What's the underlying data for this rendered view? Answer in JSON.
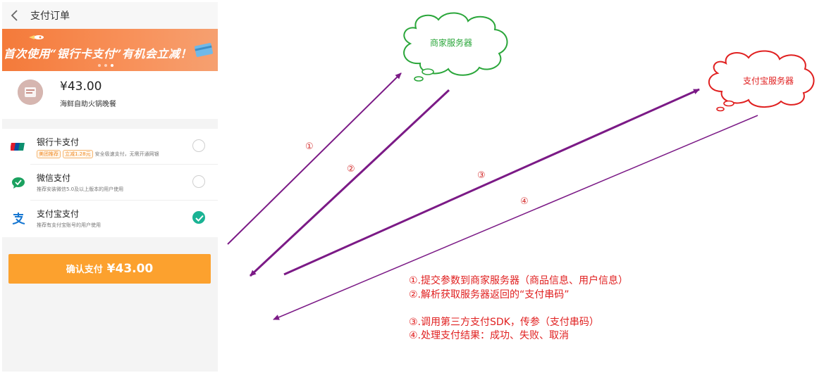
{
  "phone": {
    "nav_title": "支付订单",
    "banner_text": "首次使用“银行卡支付”有机会立减！",
    "order": {
      "price": "¥43.00",
      "name": "海鲜自助火锅晚餐"
    },
    "methods": [
      {
        "title": "银行卡支付",
        "tags": [
          "美团推荐",
          "立减1.28元"
        ],
        "desc": "安全极速支付，无需开通网银",
        "icon": "unionpay-icon",
        "checked": false
      },
      {
        "title": "微信支付",
        "desc": "推荐安装微信5.0及以上版本的用户使用",
        "icon": "wechat-pay-icon",
        "checked": false
      },
      {
        "title": "支付宝支付",
        "desc": "推荐有支付宝账号的用户使用",
        "icon": "alipay-icon",
        "checked": true
      }
    ],
    "confirm_label": "确认支付",
    "confirm_amount": "¥43.00"
  },
  "diagram": {
    "merchant_server": "商家服务器",
    "alipay_server": "支付宝服务器",
    "merchant_cloud_color": "#2aa63a",
    "alipay_cloud_color": "#e02020",
    "arrow_color": "#7b1a86",
    "steps": [
      "①",
      "②",
      "③",
      "④"
    ],
    "legend": [
      "①.提交参数到商家服务器（商品信息、用户信息）",
      "②.解析获取服务器返回的“支付串码”",
      "",
      "③.调用第三方支付SDK，传参（支付串码）",
      "④.处理支付结果：成功、失败、取消"
    ]
  }
}
